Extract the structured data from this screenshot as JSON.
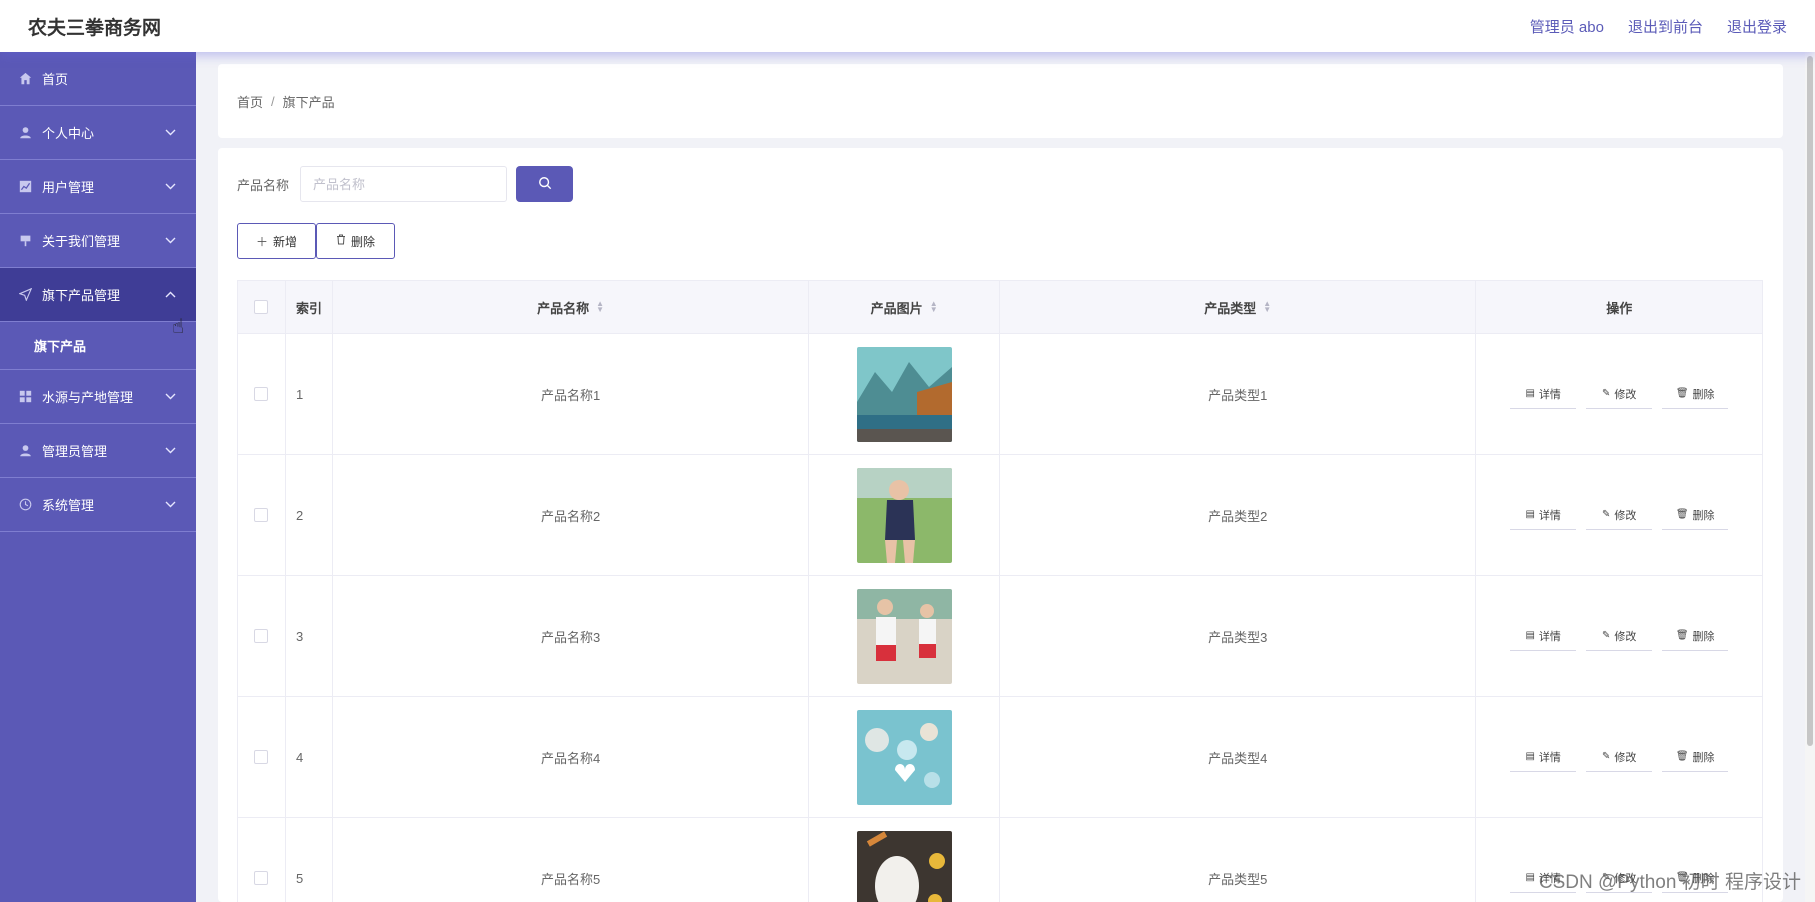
{
  "header": {
    "brand": "农夫三拳商务网",
    "admin_label": "管理员 abo",
    "front_label": "退出到前台",
    "logout_label": "退出登录"
  },
  "sidebar": {
    "items": [
      {
        "label": "首页",
        "icon": "home-icon"
      },
      {
        "label": "个人中心",
        "icon": "user-icon"
      },
      {
        "label": "用户管理",
        "icon": "chart-icon"
      },
      {
        "label": "关于我们管理",
        "icon": "flag-icon"
      },
      {
        "label": "旗下产品管理",
        "icon": "send-icon"
      },
      {
        "label": "水源与产地管理",
        "icon": "grid-icon"
      },
      {
        "label": "管理员管理",
        "icon": "admin-icon"
      },
      {
        "label": "系统管理",
        "icon": "clock-icon"
      }
    ],
    "submenu_label": "旗下产品"
  },
  "breadcrumb": {
    "home": "首页",
    "current": "旗下产品"
  },
  "search": {
    "label": "产品名称",
    "placeholder": "产品名称",
    "value": ""
  },
  "actions": {
    "add_label": "新增",
    "delete_label": "删除"
  },
  "table": {
    "headers": {
      "index": "索引",
      "name": "产品名称",
      "image": "产品图片",
      "type": "产品类型",
      "ops": "操作"
    },
    "op_labels": {
      "detail": "详情",
      "edit": "修改",
      "delete": "删除"
    },
    "rows": [
      {
        "index": "1",
        "name": "产品名称1",
        "type": "产品类型1",
        "image_desc": "mountain-lake"
      },
      {
        "index": "2",
        "name": "产品名称2",
        "type": "产品类型2",
        "image_desc": "swimsuit-navy"
      },
      {
        "index": "3",
        "name": "产品名称3",
        "type": "产品类型3",
        "image_desc": "swimsuit-red"
      },
      {
        "index": "4",
        "name": "产品名称4",
        "type": "产品类型4",
        "image_desc": "blue-candles"
      },
      {
        "index": "5",
        "name": "产品名称5",
        "type": "产品类型5",
        "image_desc": "face-mask"
      }
    ]
  },
  "watermark": "CSDN @Python 初时 程序设计",
  "colors": {
    "accent": "#5b59b6",
    "sidebar_active": "#3f3d96"
  }
}
